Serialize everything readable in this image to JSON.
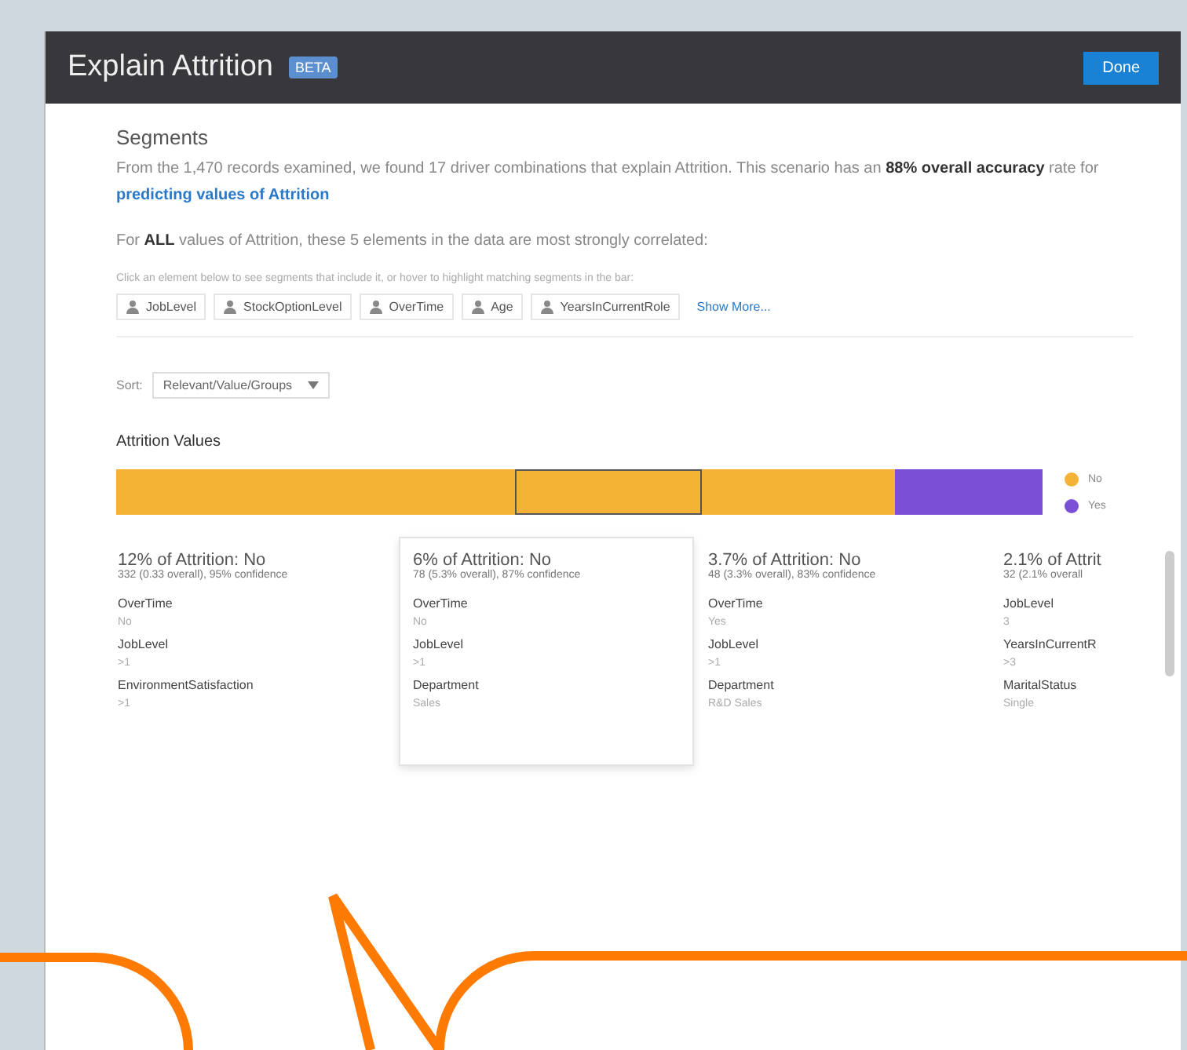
{
  "window": {
    "title": "Explain Attrition",
    "badge": "BETA",
    "done_button": "Done"
  },
  "segments": {
    "heading": "Segments",
    "summary": "From the 1,470 records examined, we found 17 driver combinations that explain Attrition. This scenario has an **88% overall accuracy** rate for",
    "summary_link": "predicting values of Attrition",
    "correlation": "For **ALL** values of Attrition, these 5 elements in the data are most strongly correlated:",
    "hint": "Click an element below to see segments that include it, or hover to highlight matching segments in the bar:",
    "chips": [
      {
        "label": "JobLevel"
      },
      {
        "label": "StockOptionLevel"
      },
      {
        "label": "OverTime"
      },
      {
        "label": "Age"
      },
      {
        "label": "YearsInCurrentRole"
      }
    ],
    "show_more": "Show More...",
    "sort_label": "Sort:",
    "sort_value": "Relevant/Value/Groups",
    "bar_title": "Attrition Values",
    "bar": {
      "level": 0.84
    },
    "legend": [
      {
        "label": "No",
        "color": "#f5b335"
      },
      {
        "label": "Yes",
        "color": "#7b4fd6"
      }
    ],
    "cards": [
      {
        "title": "12% of Attrition: No",
        "detail": "332 (0.33 overall), 95% confidence",
        "selected": false,
        "fields": [
          {
            "name": "OverTime",
            "value": "No"
          },
          {
            "name": "JobLevel",
            "value": ">1"
          },
          {
            "name": "EnvironmentSatisfaction",
            "value": ">1"
          }
        ]
      },
      {
        "title": "6% of Attrition: No",
        "detail": "78 (5.3% overall), 87% confidence",
        "selected": true,
        "fields": [
          {
            "name": "OverTime",
            "value": "No"
          },
          {
            "name": "JobLevel",
            "value": ">1"
          },
          {
            "name": "Department",
            "value": "Sales"
          }
        ]
      },
      {
        "title": "3.7% of Attrition: No",
        "detail": "48 (3.3% overall), 83% confidence",
        "selected": false,
        "fields": [
          {
            "name": "OverTime",
            "value": "Yes"
          },
          {
            "name": "JobLevel",
            "value": ">1"
          },
          {
            "name": "Department",
            "value": "R&D Sales"
          }
        ]
      },
      {
        "title": "2.1% of Attrit",
        "detail": "32 (2.1% overall",
        "selected": false,
        "fields": [
          {
            "name": "JobLevel",
            "value": "3"
          },
          {
            "name": "YearsInCurrentR",
            "value": ">3"
          },
          {
            "name": "MaritalStatus",
            "value": "Single"
          }
        ]
      }
    ]
  }
}
